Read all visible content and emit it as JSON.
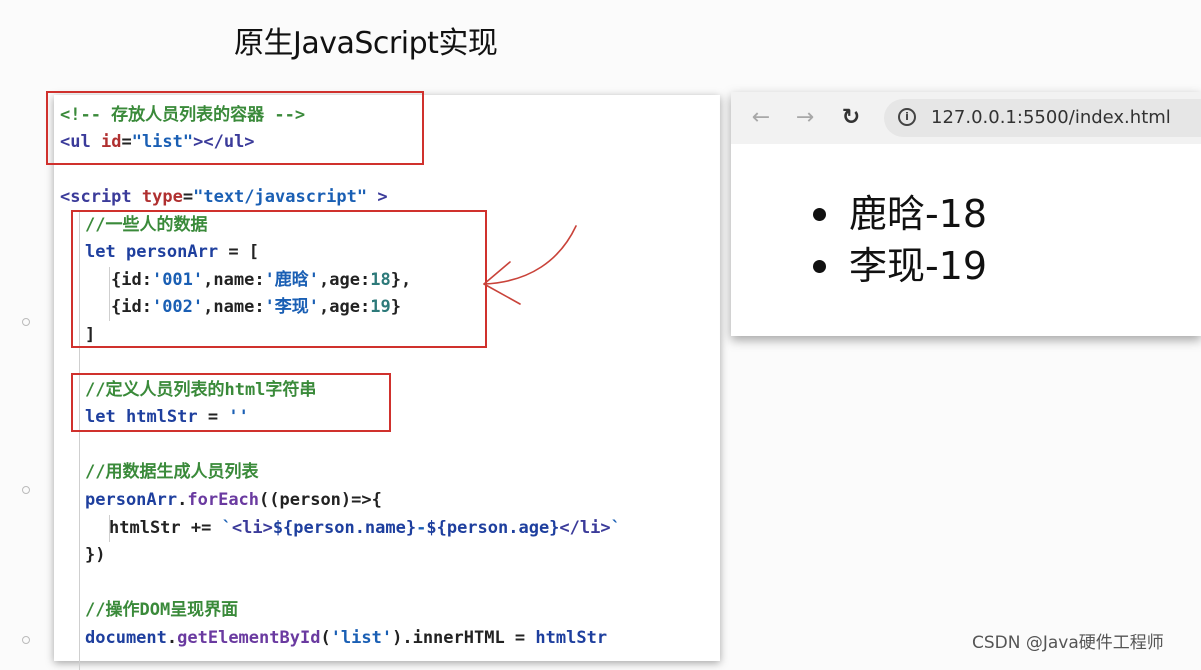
{
  "title": "原生JavaScript实现",
  "code": {
    "comment_container": "<!-- 存放人员列表的容器 -->",
    "ul_open": "<ul",
    "ul_attr": "id",
    "ul_eq": "=",
    "ul_value": "\"list\"",
    "ul_close": "></ul>",
    "script_open": "<script",
    "script_attr": "type",
    "script_eq": "=",
    "script_value": "\"text/javascript\"",
    "script_end": " >",
    "comment_data": "//一些人的数据",
    "let1_kw": "let",
    "let1_name": "personArr",
    "let1_rest": " = [",
    "row1_a": "{id:",
    "row1_id": "'001'",
    "row1_b": ",name:",
    "row1_name": "'鹿晗'",
    "row1_c": ",age:",
    "row1_age": "18",
    "row1_d": "},",
    "row2_a": "{id:",
    "row2_id": "'002'",
    "row2_b": ",name:",
    "row2_name": "'李现'",
    "row2_c": ",age:",
    "row2_age": "19",
    "row2_d": "}",
    "close_bracket": "]",
    "comment_html": "//定义人员列表的html字符串",
    "let2_kw": "let",
    "let2_name": "htmlStr",
    "let2_eq": " = ",
    "let2_val": "''",
    "comment_gen": "//用数据生成人员列表",
    "foreach_obj": "personArr",
    "foreach_dot": ".",
    "foreach_fn": "forEach",
    "foreach_rest": "((person)=>{",
    "html_var": "htmlStr",
    "html_op": " += ",
    "tpl_1": "`",
    "tpl_2": "<li>",
    "tpl_3": "${person.name}",
    "tpl_4": "-",
    "tpl_5": "${person.age}",
    "tpl_6": "</li>",
    "tpl_7": "`",
    "close_foreach": "})",
    "comment_dom": "//操作DOM呈现界面",
    "doc_obj": "document",
    "doc_dot": ".",
    "doc_fn": "getElementById",
    "doc_paren": "(",
    "doc_arg": "'list'",
    "doc_rest": ").innerHTML = ",
    "doc_var": "htmlStr"
  },
  "browser": {
    "back_icon": "←",
    "forward_icon": "→",
    "reload_icon": "↻",
    "info_icon": "i",
    "url": "127.0.0.1:5500/index.html",
    "items": [
      "鹿晗-18",
      "李现-19"
    ]
  },
  "watermark": "CSDN @Java硬件工程师"
}
